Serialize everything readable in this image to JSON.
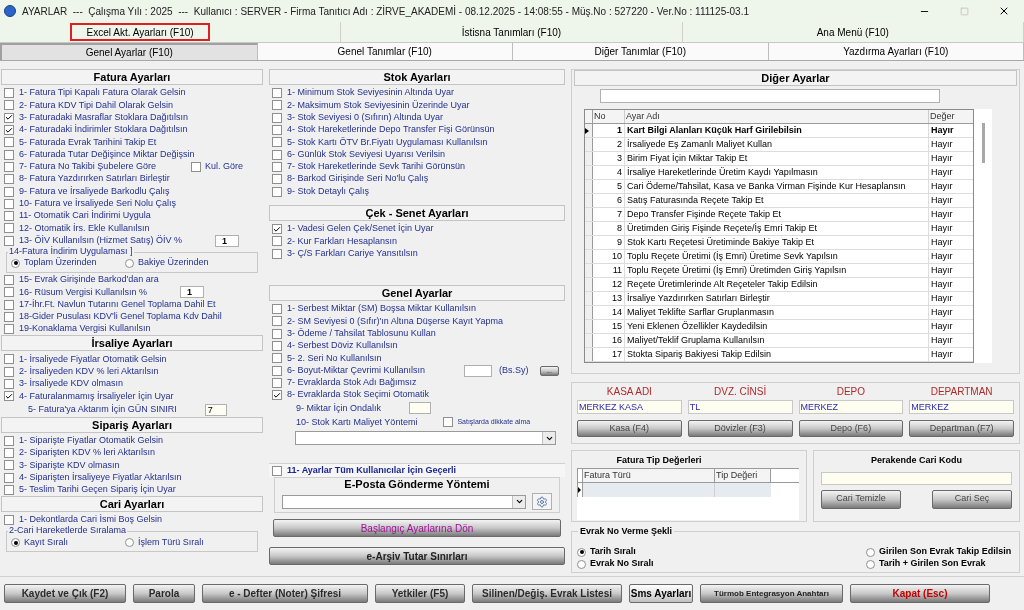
{
  "window": {
    "title": "AYARLAR  ---  Çalışma Yılı : 2025  ---  Kullanıcı : SERVER - Firma Tanıtıcı Adı : ZİRVE_AKADEMİ - 08.12.2025 - 14:08:55 - Müş.No : 527220 - Ver.No : 111125-03.1"
  },
  "top_tabs": [
    {
      "label": "Excel Akt. Ayarları (F10)",
      "highlighted": true
    },
    {
      "label": "İstisna Tanımları (F10)",
      "highlighted": false
    },
    {
      "label": "Ana Menü (F10)",
      "highlighted": false
    }
  ],
  "tabs": [
    {
      "label": "Genel Ayarlar (F10)",
      "selected": true
    },
    {
      "label": "Genel Tanımlar (F10)",
      "selected": false
    },
    {
      "label": "Diğer Tanımlar (F10)",
      "selected": false
    },
    {
      "label": "Yazdırma Ayarları (F10)",
      "selected": false
    }
  ],
  "left_sections": [
    {
      "title": "Fatura Ayarları",
      "rows": [
        {
          "kind": "check",
          "label": "1- Fatura Tipi Kapalı Fatura Olarak Gelsin",
          "checked": false
        },
        {
          "kind": "check",
          "label": "2- Fatura KDV Tipi Dahil Olarak Gelsin",
          "checked": false
        },
        {
          "kind": "check",
          "label": "3- Faturadaki Masraflar Stoklara Dağıtılsın",
          "checked": true
        },
        {
          "kind": "check",
          "label": "4- Faturadaki İndirimler Stoklara Dağıtılsın",
          "checked": true
        },
        {
          "kind": "check",
          "label": "5- Faturada Evrak Tarihini Takip Et",
          "checked": false
        },
        {
          "kind": "check",
          "label": "6- Faturada Tutar Değişince Miktar Değişsin",
          "checked": false
        },
        {
          "kind": "check",
          "label": "7- Fatura No Takibi Şubelere Göre",
          "checked": false,
          "side_check": {
            "label": "Kul. Göre",
            "checked": false
          }
        },
        {
          "kind": "check",
          "label": "8- Fatura Yazdırırken Satırları Birleştir",
          "checked": false
        },
        {
          "kind": "check",
          "label": "9- Fatura ve İrsaliyede Barkodlu Çalış",
          "checked": false
        },
        {
          "kind": "check",
          "label": "10- Fatura ve İrsaliyede Seri Nolu Çalış",
          "checked": false
        },
        {
          "kind": "check",
          "label": "11- Otomatik Cari İndirimi Uygula",
          "checked": false
        },
        {
          "kind": "check",
          "label": "12- Otomatik İrs. Ekle Kullanılsın",
          "checked": false
        },
        {
          "kind": "check",
          "label": "13- ÖİV Kullanılsın (Hizmet Satış) ÖİV %",
          "checked": false,
          "value": "1"
        },
        {
          "kind": "radio_group",
          "title": "14-Fatura İndirim Uygulaması ]",
          "options": [
            {
              "label": "Toplam Üzerinden",
              "selected": true
            },
            {
              "label": "Bakiye Üzerinden",
              "selected": false
            }
          ]
        },
        {
          "kind": "check",
          "label": "15- Evrak Girişinde Barkod'dan ara",
          "checked": false
        },
        {
          "kind": "check",
          "label": "16- Rüsum Vergisi Kullanılsın %",
          "checked": false,
          "value": "1"
        },
        {
          "kind": "check",
          "label": "17-İhr.Ft. Navlun Tutarını Genel Toplama Dahil Et",
          "checked": false
        },
        {
          "kind": "check",
          "label": "18-Gider Pusulası KDV'li Genel Toplama Kdv Dahil",
          "checked": false
        },
        {
          "kind": "check",
          "label": "19-Konaklama Vergisi Kullanılsın",
          "checked": false
        }
      ]
    },
    {
      "title": "İrsaliye Ayarları",
      "rows": [
        {
          "kind": "check",
          "label": "1- İrsaliyede Fiyatlar Otomatik Gelsin",
          "checked": false
        },
        {
          "kind": "check",
          "label": "2- İrsaliyeden KDV % leri Aktarılsın",
          "checked": false
        },
        {
          "kind": "check",
          "label": "3- İrsaliyede KDV olmasın",
          "checked": false
        },
        {
          "kind": "check",
          "label": "4- Faturalanmamış İrsaliyeler İçin Uyar",
          "checked": true
        },
        {
          "kind": "field",
          "label": "5- Fatura'ya Aktarım İçin GÜN SINIRI",
          "value": "7"
        }
      ]
    },
    {
      "title": "Sipariş Ayarları",
      "rows": [
        {
          "kind": "check",
          "label": "1- Siparişte Fiyatlar Otomatik Gelsin",
          "checked": false
        },
        {
          "kind": "check",
          "label": "2- Siparişten KDV % leri Aktarılsın",
          "checked": false
        },
        {
          "kind": "check",
          "label": "3- Siparişte KDV olmasın",
          "checked": false
        },
        {
          "kind": "check",
          "label": "4- Siparişten İrsaliyeye Fiyatlar Aktarılsın",
          "checked": false
        },
        {
          "kind": "check",
          "label": "5- Teslim Tarihi Geçen Sipariş İçin Uyar",
          "checked": false
        }
      ]
    },
    {
      "title": "Cari Ayarları",
      "rows": [
        {
          "kind": "check",
          "label": "1- Dekontlarda Cari İsmi Boş Gelsin",
          "checked": false
        },
        {
          "kind": "radio_group",
          "title": "2-Cari Hareketlerde Sıralama",
          "options": [
            {
              "label": "Kayıt Sıralı",
              "selected": true
            },
            {
              "label": "İşlem Türü Sıralı",
              "selected": false
            }
          ]
        }
      ]
    }
  ],
  "middle_sections": [
    {
      "title": "Stok Ayarları",
      "rows": [
        {
          "kind": "check",
          "label": "1- Minimum Stok Seviyesinin Altında Uyar",
          "checked": false
        },
        {
          "kind": "check",
          "label": "2- Maksimum Stok Seviyesinin Üzerinde Uyar",
          "checked": false
        },
        {
          "kind": "check",
          "label": "3- Stok Seviyesi 0 (Sıfırın) Altında Uyar",
          "checked": false
        },
        {
          "kind": "check",
          "label": "4- Stok Hareketlerinde Depo Transfer Fişi Görünsün",
          "checked": false
        },
        {
          "kind": "check",
          "label": "5- Stok Kartı ÖTV Br.Fiyatı Uygulaması Kullanılsın",
          "checked": false
        },
        {
          "kind": "check",
          "label": "6- Günlük Stok Seviyesi Uyarısı Verilsin",
          "checked": false
        },
        {
          "kind": "check",
          "label": "7- Stok Hareketlerinde Sevk Tarihi Görünsün",
          "checked": false
        },
        {
          "kind": "check",
          "label": "8- Barkod Girişinde Seri No'lu Çalış",
          "checked": false
        },
        {
          "kind": "check",
          "label": "9- Stok Detaylı Çalış",
          "checked": false
        }
      ]
    },
    {
      "title": "Çek - Senet Ayarları",
      "rows": [
        {
          "kind": "check",
          "label": "1- Vadesi Gelen Çek/Senet İçin Uyar",
          "checked": true
        },
        {
          "kind": "check",
          "label": "2- Kur Farkları Hesaplansın",
          "checked": false
        },
        {
          "kind": "check",
          "label": "3- Ç/S Farkları Cariye Yansıtılsın",
          "checked": false
        }
      ]
    },
    {
      "title": "Genel Ayarlar",
      "rows": [
        {
          "kind": "check",
          "label": "1- Serbest Miktar (SM) Boşsa Miktar Kullanılsın",
          "checked": false
        },
        {
          "kind": "check",
          "label": "2- SM Seviyesi 0 (Sıfır)'ın Altına Düşerse Kayıt Yapma",
          "checked": false
        },
        {
          "kind": "check",
          "label": "3- Ödeme / Tahsilat Tablosunu Kullan",
          "checked": false
        },
        {
          "kind": "check",
          "label": "4- Serbest Döviz Kullanılsın",
          "checked": false
        },
        {
          "kind": "check",
          "label": "5- 2. Seri No Kullanılsın",
          "checked": false
        },
        {
          "kind": "check",
          "label": "6- Boyut-Miktar Çevrimi Kullanılsın",
          "checked": false,
          "unit": "(Bs.Sy)",
          "more": "..."
        },
        {
          "kind": "check",
          "label": "7- Evraklarda Stok Adı Bağımsız",
          "checked": false
        },
        {
          "kind": "check",
          "label": "8- Evraklarda Stok Seçimi Otomatik",
          "checked": true
        },
        {
          "kind": "field",
          "label": "9- Miktar İçin Ondalık"
        },
        {
          "kind": "field",
          "label": "10- Stok Kartı Maliyet Yöntemi",
          "side_check": {
            "label": "Satışlarda dikkate alma",
            "checked": false
          }
        },
        {
          "kind": "dropdown"
        }
      ]
    }
  ],
  "all_users": {
    "label": "11- Ayarlar Tüm Kullanıcılar İçin Geçerli",
    "checked": false
  },
  "email": {
    "title": "E-Posta Gönderme Yöntemi"
  },
  "middle_buttons": [
    {
      "label": "Başlangıç Ayarlarına Dön",
      "kind": "accent"
    },
    {
      "label": "e-Arşiv Tutar Sınırları",
      "kind": "plain"
    }
  ],
  "other_settings": {
    "title": "Diğer Ayarlar",
    "columns": [
      "No",
      "Ayar Adı",
      "Değer"
    ],
    "rows": [
      {
        "no": "1",
        "name": "Kart Bilgi Alanları Küçük Harf Girilebilsin",
        "value": "Hayır",
        "selected": true
      },
      {
        "no": "2",
        "name": "İrsaliyede Eş Zamanlı Maliyet Kullan",
        "value": "Hayır",
        "selected": false
      },
      {
        "no": "3",
        "name": "Birim Fiyat İçin Miktar Takip Et",
        "value": "Hayır",
        "selected": false
      },
      {
        "no": "4",
        "name": "İrsaliye Hareketlerinde Üretim Kaydı Yapılmasın",
        "value": "Hayır",
        "selected": false
      },
      {
        "no": "5",
        "name": "Cari Ödeme/Tahsilat, Kasa ve Banka Virman Fişinde Kur Hesaplansın",
        "value": "Hayır",
        "selected": false
      },
      {
        "no": "6",
        "name": "Satış Faturasında Reçete Takip Et",
        "value": "Hayır",
        "selected": false
      },
      {
        "no": "7",
        "name": "Depo Transfer Fişinde Reçete Takip Et",
        "value": "Hayır",
        "selected": false
      },
      {
        "no": "8",
        "name": "Üretimden Giriş Fişinde Reçete/İş Emri Takip Et",
        "value": "Hayır",
        "selected": false
      },
      {
        "no": "9",
        "name": "Stok Kartı Reçetesi Üretiminde Bakiye Takip Et",
        "value": "Hayır",
        "selected": false
      },
      {
        "no": "10",
        "name": "Toplu Reçete Üretimi (İş Emri) Üretime Sevk Yapılsın",
        "value": "Hayır",
        "selected": false
      },
      {
        "no": "11",
        "name": "Toplu Reçete Üretimi (İş Emri) Üretimden Giriş Yapılsın",
        "value": "Hayır",
        "selected": false
      },
      {
        "no": "12",
        "name": "Reçete Üretimlerinde Alt Reçeteler Takip Edilsin",
        "value": "Hayır",
        "selected": false
      },
      {
        "no": "13",
        "name": "İrsaliye Yazdırırken Satırları Birleştir",
        "value": "Hayır",
        "selected": false
      },
      {
        "no": "14",
        "name": "Maliyet Teklifte Sarflar Gruplanmasın",
        "value": "Hayır",
        "selected": false
      },
      {
        "no": "15",
        "name": "Yeni Eklenen Özellikler Kaydedilsin",
        "value": "Hayır",
        "selected": false
      },
      {
        "no": "16",
        "name": "Maliyet/Teklif Gruplama Kullanılsın",
        "value": "Hayır",
        "selected": false
      },
      {
        "no": "17",
        "name": "Stokta Sipariş Bakiyesi Takip Edilsin",
        "value": "Hayır",
        "selected": false
      }
    ]
  },
  "defaults": [
    {
      "label": "KASA ADI",
      "value": "MERKEZ KASA",
      "button": "Kasa (F4)"
    },
    {
      "label": "DVZ. CİNSİ",
      "value": "TL",
      "button": "Dövizler (F3)"
    },
    {
      "label": "DEPO",
      "value": "MERKEZ",
      "button": "Depo (F6)"
    },
    {
      "label": "DEPARTMAN",
      "value": "MERKEZ",
      "button": "Departman (F7)"
    }
  ],
  "invoice_types": {
    "title": "Fatura Tip Değerleri",
    "columns": [
      "Fatura Türü",
      "Tip Değeri"
    ]
  },
  "retail": {
    "title": "Perakende Cari Kodu",
    "buttons": [
      "Cari Temizle",
      "Cari Seç"
    ]
  },
  "doc_numbering": {
    "title": "Evrak No Verme Şekli",
    "options": [
      {
        "label": "Tarih Sıralı",
        "selected": true
      },
      {
        "label": "Girilen Son Evrak Takip Edilsin",
        "selected": false
      },
      {
        "label": "Evrak No Sıralı",
        "selected": false
      },
      {
        "label": "Tarih + Girilen Son Evrak",
        "selected": false
      }
    ]
  },
  "footer_buttons": [
    {
      "label": "Kaydet ve Çık (F2)",
      "kind": "normal"
    },
    {
      "label": "Parola",
      "kind": "normal"
    },
    {
      "label": "e - Defter (Noter) Şifresi",
      "kind": "normal"
    },
    {
      "label": "Yetkiler (F5)",
      "kind": "normal"
    },
    {
      "label": "Silinen/Değiş. Evrak Listesi",
      "kind": "normal"
    },
    {
      "label": "Sms Ayarları",
      "kind": "emphasis"
    },
    {
      "label": "Türmob Entegrasyon Anahtarı",
      "kind": "small"
    },
    {
      "label": "Kapat (Esc)",
      "kind": "danger"
    }
  ]
}
